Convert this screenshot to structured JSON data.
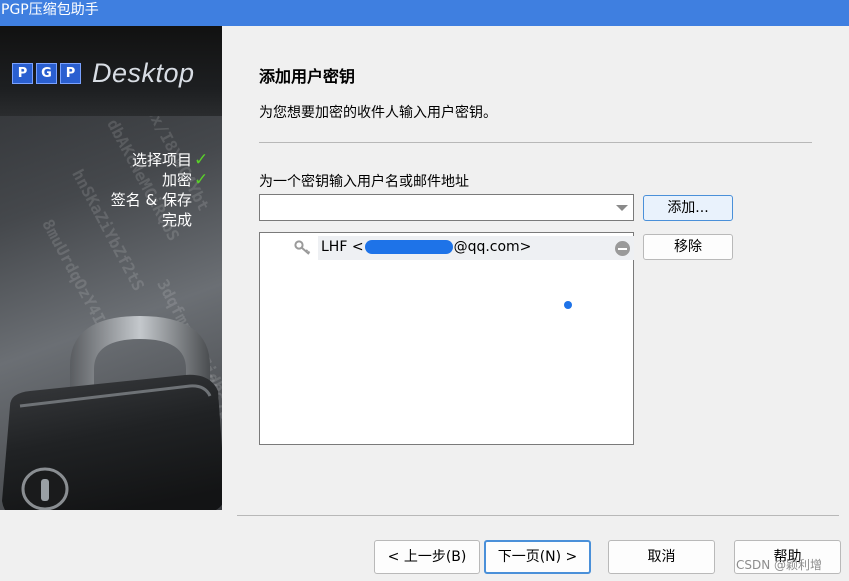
{
  "window": {
    "title": "PGP压缩包助手"
  },
  "sidebar": {
    "logo": {
      "letters": [
        "P",
        "G",
        "P"
      ],
      "product": "Desktop"
    },
    "steps": [
      {
        "label": "选择项目",
        "done": true
      },
      {
        "label": "加密",
        "done": true
      },
      {
        "label": "签名 & 保存",
        "done": false
      },
      {
        "label": "完成",
        "done": false
      }
    ],
    "check_glyph": "✓",
    "check_color": "#5ad02a",
    "watermark": [
      "L2Ux/I8XwC4Ybt",
      "dbAKcNeMCiRQbS",
      "hnSKaZiYbZf2tS",
      "8muUrdqOzY4IMK",
      "3dqfmnLbRZjdb",
      "RimZS67p6dtO2f"
    ]
  },
  "main": {
    "title": "添加用户密钥",
    "description": "为您想要加密的收件人输入用户密钥。",
    "field_label": "为一个密钥输入用户名或邮件地址",
    "combo_value": "",
    "add_button": "添加...",
    "remove_button": "移除",
    "recipients": [
      {
        "name_prefix": "LHF <",
        "email_suffix": "@qq.com>",
        "icon": "key-icon"
      }
    ]
  },
  "footer": {
    "back_button": "< 上一步(B)",
    "next_button": "下一页(N) >",
    "cancel_button": "取消",
    "help_button": "帮助"
  },
  "watermark_text": "CSDN @颖利增",
  "colors": {
    "titlebar": "#3f7fe0",
    "accent": "#1e73e8",
    "focus_border": "#4a90d9"
  }
}
